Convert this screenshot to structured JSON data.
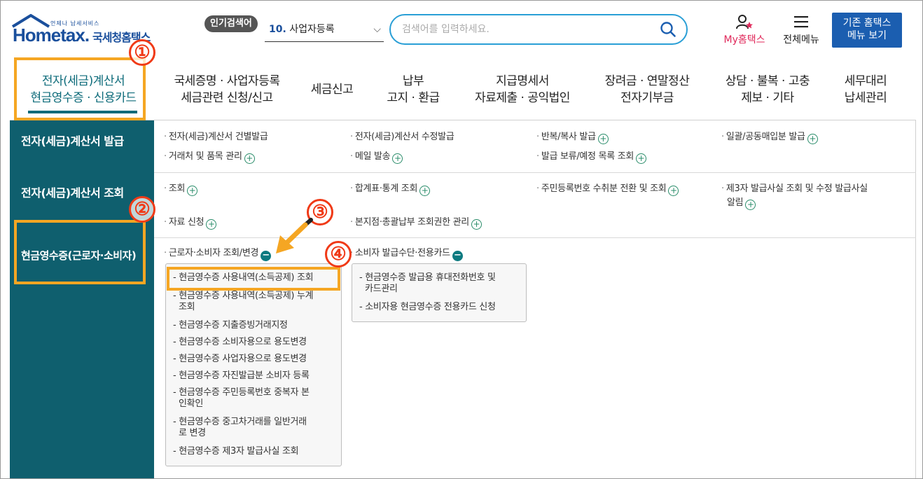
{
  "header": {
    "logo_sub": "언제나 납세서비스",
    "logo_main": "Hometax.",
    "logo_kr": "국세청홈택스",
    "popular_badge": "인기검색어",
    "popular_num": "10.",
    "popular_term": "사업자등록",
    "search_placeholder": "검색어를 입력하세요.",
    "my_label": "My홈택스",
    "menu_label": "전체메뉴",
    "legacy_line1": "기존 홈택스",
    "legacy_line2": "메뉴 보기"
  },
  "nav": [
    {
      "line1": "전자(세금)계산서",
      "line2": "현금영수증 · 신용카드"
    },
    {
      "line1": "국세증명 · 사업자등록",
      "line2": "세금관련 신청/신고"
    },
    {
      "line1": "세금신고",
      "line2": ""
    },
    {
      "line1": "납부",
      "line2": "고지 · 환급"
    },
    {
      "line1": "지급명세서",
      "line2": "자료제출 · 공익법인"
    },
    {
      "line1": "장려금 · 연말정산",
      "line2": "전자기부금"
    },
    {
      "line1": "상담 · 불복 · 고충",
      "line2": "제보 · 기타"
    },
    {
      "line1": "세무대리",
      "line2": "납세관리"
    }
  ],
  "sidebar": {
    "cat1": "전자(세금)계산서 발급",
    "cat2": "전자(세금)계산서 조회",
    "cat3": "현금영수증(근로자·소비자)"
  },
  "issue": {
    "a": "전자(세금)계산서 건별발급",
    "b": "전자(세금)계산서 수정발급",
    "c": "반복/복사 발급",
    "d": "일괄/공동매입분 발급",
    "e": "거래처 및 품목 관리",
    "f": "메일 발송",
    "g": "발급 보류/예정 목록 조회"
  },
  "inquiry": {
    "a": "조회",
    "b": "합계표·통계 조회",
    "c": "주민등록번호 수취분 전환 및 조회",
    "d1": "제3자 발급사실 조회 및 수정 발급사실",
    "d2": "알림",
    "e": "자료 신청",
    "f": "본지점·총괄납부 조회권한 관리"
  },
  "cash": {
    "group1": "근로자·소비자 조회/변경",
    "group2": "소비자 발급수단·전용카드",
    "items1": [
      "현금영수증 사용내역(소득공제) 조회",
      "현금영수증 사용내역(소득공제) 누계",
      "조회",
      "현금영수증 지출증빙거래지정",
      "현금영수증 소비자용으로 용도변경",
      "현금영수증 사업자용으로 용도변경",
      "현금영수증 자진발급분 소비자 등록",
      "현금영수증 주민등록번호 중복자 본",
      "인확인",
      "현금영수증 중고차거래를 일반거래",
      "로 변경",
      "현금영수증 제3자 발급사실 조회"
    ],
    "items2": [
      "현금영수증 발급용 휴대전화번호 및",
      "카드관리",
      "소비자용 현금영수증 전용카드 신청"
    ]
  },
  "annotations": [
    "①",
    "②",
    "③",
    "④"
  ],
  "colors": {
    "accent": "#0f5f6e",
    "highlight": "#f5a623",
    "marker": "#f03a17",
    "brand": "#1a4f9c"
  }
}
